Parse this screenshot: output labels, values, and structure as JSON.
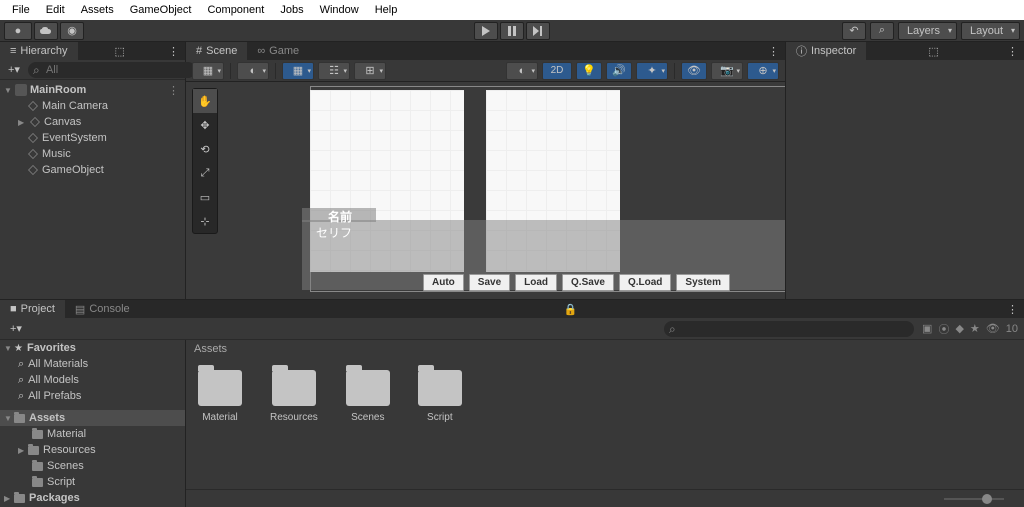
{
  "menu": {
    "items": [
      "File",
      "Edit",
      "Assets",
      "GameObject",
      "Component",
      "Jobs",
      "Window",
      "Help"
    ]
  },
  "toolbar": {
    "layers": "Layers",
    "layout": "Layout"
  },
  "hierarchy": {
    "title": "Hierarchy",
    "search_placeholder": "All",
    "root": "MainRoom",
    "children": [
      "Main Camera",
      "Canvas",
      "EventSystem",
      "Music",
      "GameObject"
    ]
  },
  "scene": {
    "tabs": [
      "Scene",
      "Game"
    ],
    "mode_2d": "2D",
    "overlay_name": "名前",
    "overlay_dialogue": "セリフ",
    "buttons": [
      "Auto",
      "Save",
      "Load",
      "Q.Save",
      "Q.Load",
      "System"
    ]
  },
  "inspector": {
    "title": "Inspector"
  },
  "project": {
    "tabs": [
      "Project",
      "Console"
    ],
    "favorites": "Favorites",
    "fav_items": [
      "All Materials",
      "All Models",
      "All Prefabs"
    ],
    "assets": "Assets",
    "asset_items": [
      "Material",
      "Resources",
      "Scenes",
      "Script"
    ],
    "packages": "Packages",
    "breadcrumb": "Assets",
    "folders": [
      "Material",
      "Resources",
      "Scenes",
      "Script"
    ],
    "hidden_count": "10"
  }
}
